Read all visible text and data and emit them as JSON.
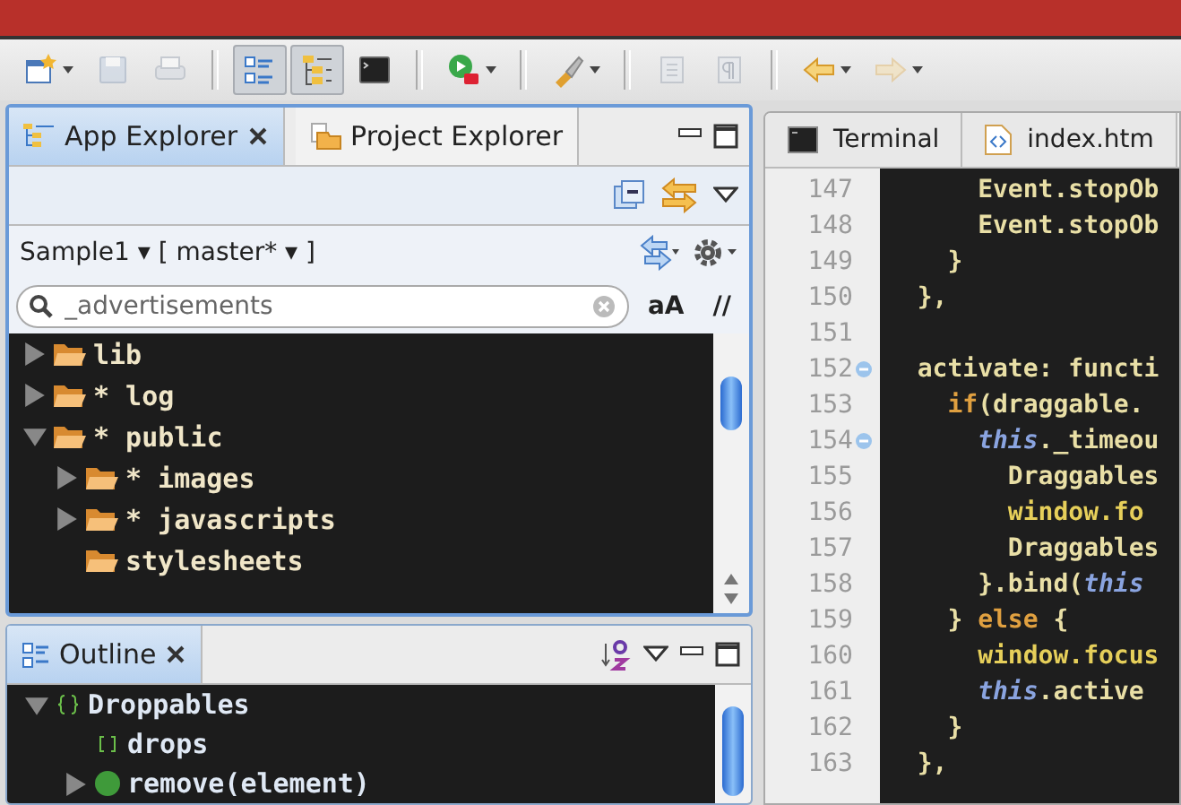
{
  "toolbar": [
    {
      "kind": "new",
      "dropdown": true,
      "pressed": false,
      "disabled": false
    },
    {
      "kind": "save",
      "dropdown": false,
      "pressed": false,
      "disabled": true
    },
    {
      "kind": "print",
      "dropdown": false,
      "pressed": false,
      "disabled": true
    },
    {
      "kind": "separator"
    },
    {
      "kind": "outline",
      "dropdown": false,
      "pressed": true,
      "disabled": false
    },
    {
      "kind": "tree",
      "dropdown": false,
      "pressed": true,
      "disabled": false
    },
    {
      "kind": "terminal",
      "dropdown": false,
      "pressed": false,
      "disabled": false
    },
    {
      "kind": "separator"
    },
    {
      "kind": "run",
      "dropdown": true,
      "pressed": false,
      "disabled": false
    },
    {
      "kind": "separator"
    },
    {
      "kind": "brush",
      "dropdown": true,
      "pressed": false,
      "disabled": false
    },
    {
      "kind": "separator"
    },
    {
      "kind": "page",
      "dropdown": false,
      "pressed": false,
      "disabled": true
    },
    {
      "kind": "pilcrow",
      "dropdown": false,
      "pressed": false,
      "disabled": true
    },
    {
      "kind": "separator"
    },
    {
      "kind": "back",
      "dropdown": true,
      "pressed": false,
      "disabled": false
    },
    {
      "kind": "forward",
      "dropdown": true,
      "pressed": false,
      "disabled": true
    }
  ],
  "explorer": {
    "tabs": [
      {
        "label": "App Explorer",
        "selected": true
      },
      {
        "label": "Project Explorer",
        "selected": false
      }
    ],
    "project": "Sample1 ▾ [  master* ▾ ]",
    "search": {
      "value": "_advertisements"
    },
    "case_toggle": "aA",
    "comment_toggle": "//",
    "tree": [
      {
        "label": "lib",
        "has_children": true,
        "expanded": false
      },
      {
        "label": "* log",
        "has_children": true,
        "expanded": false
      },
      {
        "label": "* public",
        "has_children": true,
        "expanded": true,
        "children": [
          {
            "label": "* images",
            "has_children": true,
            "expanded": false
          },
          {
            "label": "* javascripts",
            "has_children": true,
            "expanded": false
          },
          {
            "label": "stylesheets",
            "has_children": false
          }
        ]
      }
    ]
  },
  "outline": {
    "tab": {
      "label": "Outline",
      "selected": true
    },
    "items": [
      {
        "label": "Droppables",
        "kind": "object",
        "has_children": true,
        "expanded": true,
        "children": [
          {
            "label": "drops",
            "kind": "array",
            "has_children": false
          },
          {
            "label": "remove(element)",
            "kind": "function",
            "has_children": true,
            "expanded": false
          }
        ]
      }
    ]
  },
  "editor": {
    "tabs": [
      {
        "label": "Terminal",
        "kind": "terminal",
        "selected": false
      },
      {
        "label": "index.htm",
        "kind": "html",
        "selected": false
      }
    ],
    "lines": [
      {
        "number": "147",
        "fold": false,
        "tokens": [
          {
            "text": "      Event.stopOb",
            "kind": "plain"
          }
        ]
      },
      {
        "number": "148",
        "fold": false,
        "tokens": [
          {
            "text": "      Event.stopOb",
            "kind": "plain"
          }
        ]
      },
      {
        "number": "149",
        "fold": false,
        "tokens": [
          {
            "text": "    }",
            "kind": "plain"
          }
        ]
      },
      {
        "number": "150",
        "fold": false,
        "tokens": [
          {
            "text": "  },",
            "kind": "plain"
          }
        ]
      },
      {
        "number": "151",
        "fold": false
      },
      {
        "number": "152",
        "fold": true,
        "tokens": [
          {
            "text": "  activate: functi",
            "kind": "plain"
          }
        ]
      },
      {
        "number": "153",
        "fold": false,
        "tokens": [
          {
            "text": "    if",
            "kind": "keyword"
          },
          {
            "text": "(draggable.",
            "kind": "plain"
          }
        ]
      },
      {
        "number": "154",
        "fold": true,
        "tokens": [
          {
            "text": "      this",
            "kind": "this"
          },
          {
            "text": "._timeou",
            "kind": "plain"
          }
        ]
      },
      {
        "number": "155",
        "fold": false,
        "tokens": [
          {
            "text": "        Draggables",
            "kind": "plain"
          }
        ]
      },
      {
        "number": "156",
        "fold": false,
        "tokens": [
          {
            "text": "        window.fo",
            "kind": "call"
          }
        ]
      },
      {
        "number": "157",
        "fold": false,
        "tokens": [
          {
            "text": "        Draggables",
            "kind": "plain"
          }
        ]
      },
      {
        "number": "158",
        "fold": false,
        "tokens": [
          {
            "text": "      }.bind(",
            "kind": "plain"
          },
          {
            "text": "this",
            "kind": "this"
          }
        ]
      },
      {
        "number": "159",
        "fold": false,
        "tokens": [
          {
            "text": "    } ",
            "kind": "plain"
          },
          {
            "text": "else",
            "kind": "keyword"
          },
          {
            "text": " {",
            "kind": "plain"
          }
        ]
      },
      {
        "number": "160",
        "fold": false,
        "tokens": [
          {
            "text": "      window.focus",
            "kind": "call"
          }
        ]
      },
      {
        "number": "161",
        "fold": false,
        "tokens": [
          {
            "text": "      this",
            "kind": "this"
          },
          {
            "text": ".active",
            "kind": "plain"
          }
        ]
      },
      {
        "number": "162",
        "fold": false,
        "tokens": [
          {
            "text": "    }",
            "kind": "plain"
          }
        ]
      },
      {
        "number": "163",
        "fold": false,
        "tokens": [
          {
            "text": "  },",
            "kind": "plain"
          }
        ]
      }
    ]
  }
}
